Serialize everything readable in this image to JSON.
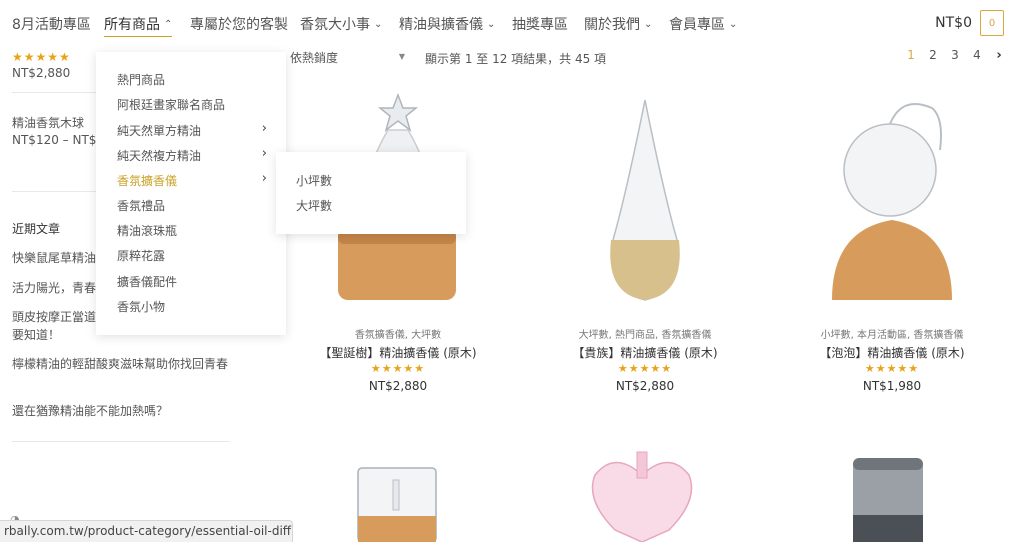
{
  "nav": {
    "items": [
      {
        "label": "8月活動專區",
        "chevron": false
      },
      {
        "label": "所有商品",
        "chevron": true
      },
      {
        "label": "專屬於您的客製",
        "chevron": false
      },
      {
        "label": "香氛大小事",
        "chevron": true
      },
      {
        "label": "精油與擴香儀",
        "chevron": true
      },
      {
        "label": "抽獎專區",
        "chevron": false
      },
      {
        "label": "關於我們",
        "chevron": true
      },
      {
        "label": "會員專區",
        "chevron": true
      }
    ],
    "cart_total": "NT$0",
    "cart_count": "0"
  },
  "sidebar": {
    "top_stars": "★★★★★",
    "top_price": "NT$2,880",
    "product_name": "精油香氛木球",
    "product_price": "NT$120 – NT$",
    "recent_heading": "近期文章",
    "posts": [
      "快樂鼠尾草精油",
      "活力陽光，青春",
      "頭皮按摩正當道",
      "要知道！",
      "檸檬精油的輕甜酸爽滋味幫助你找回青春",
      "還在猶豫精油能不能加熱嗎？"
    ]
  },
  "toolbar": {
    "sort_label": "依熱銷度",
    "results_text": "顯示第 1 至 12 項結果，共 45 項",
    "pages": [
      "1",
      "2",
      "3",
      "4"
    ],
    "next": "›"
  },
  "products": [
    {
      "categories": "香氛擴香儀, 大坪數",
      "title": "【聖誕樹】精油擴香儀 (原木)",
      "stars": "★★★★★",
      "price": "NT$2,880"
    },
    {
      "categories": "大坪數, 熱門商品, 香氛擴香儀",
      "title": "【貴族】精油擴香儀 (原木)",
      "stars": "★★★★★",
      "price": "NT$2,880"
    },
    {
      "categories": "小坪數, 本月活動區, 香氛擴香儀",
      "title": "【泡泡】精油擴香儀 (原木)",
      "stars": "★★★★★",
      "price": "NT$1,980"
    }
  ],
  "menu": {
    "items": [
      {
        "label": "熱門商品",
        "has_sub": false
      },
      {
        "label": "阿根廷畫家聯名商品",
        "has_sub": false
      },
      {
        "label": "純天然單方精油",
        "has_sub": true
      },
      {
        "label": "純天然複方精油",
        "has_sub": true
      },
      {
        "label": "香氛擴香儀",
        "has_sub": true,
        "active": true
      },
      {
        "label": "香氛禮品",
        "has_sub": false
      },
      {
        "label": "精油滾珠瓶",
        "has_sub": false
      },
      {
        "label": "原粹花露",
        "has_sub": false
      },
      {
        "label": "擴香儀配件",
        "has_sub": false
      },
      {
        "label": "香氛小物",
        "has_sub": false
      }
    ],
    "submenu": [
      "小坪數",
      "大坪數"
    ]
  },
  "status_url": "rbally.com.tw/product-category/essential-oil-diffuser/",
  "colors": {
    "accent": "#c9a227",
    "star": "#e8a317"
  }
}
